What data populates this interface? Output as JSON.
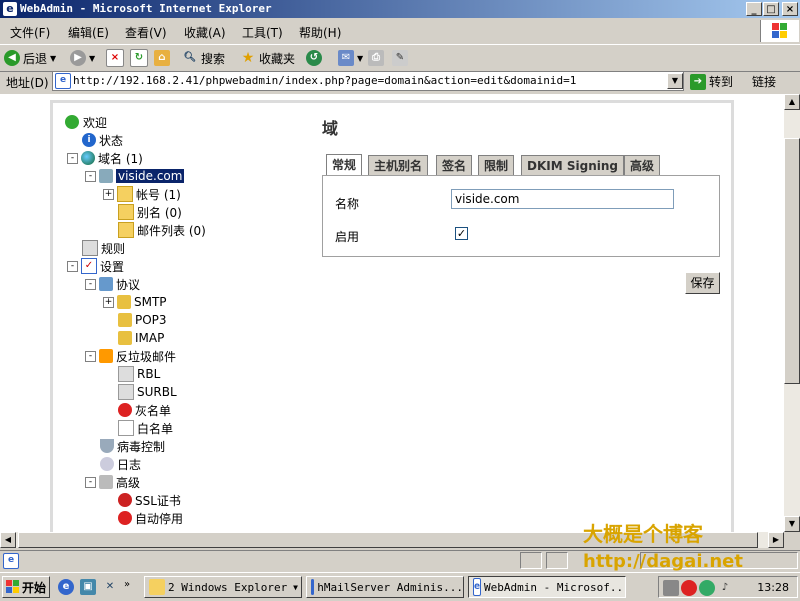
{
  "window": {
    "title": "WebAdmin - Microsoft Internet Explorer",
    "minimize": "_",
    "maximize": "□",
    "close": "×"
  },
  "menu": [
    "文件(F)",
    "编辑(E)",
    "查看(V)",
    "收藏(A)",
    "工具(T)",
    "帮助(H)"
  ],
  "toolbar": {
    "back": "后退",
    "search": "搜索",
    "favorites": "收藏夹"
  },
  "address": {
    "label": "地址(D)",
    "url": "http://192.168.2.41/phpwebadmin/index.php?page=domain&action=edit&domainid=1",
    "go": "转到",
    "links": "链接"
  },
  "tree": {
    "welcome": "欢迎",
    "status": "状态",
    "domains": "域名 (1)",
    "domain_item": "viside.com",
    "accounts": "帐号 (1)",
    "aliases": "别名 (0)",
    "lists": "邮件列表 (0)",
    "rules": "规则",
    "settings": "设置",
    "protocols": "协议",
    "smtp": "SMTP",
    "pop3": "POP3",
    "imap": "IMAP",
    "antispam": "反垃圾邮件",
    "rbl": "RBL",
    "surbl": "SURBL",
    "greylist": "灰名单",
    "whitelist": "白名单",
    "antivirus": "病毒控制",
    "logging": "日志",
    "advanced": "高级",
    "ssl": "SSL证书",
    "autoban": "自动停用"
  },
  "main": {
    "title": "域",
    "tabs": [
      "常规",
      "主机别名",
      "签名",
      "限制",
      "DKIM Signing",
      "高级"
    ],
    "name_label": "名称",
    "name_value": "viside.com",
    "enabled_label": "启用",
    "enabled": true,
    "save": "保存"
  },
  "taskbar": {
    "start": "开始",
    "task1": "2 Windows Explorer",
    "task2": "hMailServer Adminis...",
    "task3": "WebAdmin - Microsof...",
    "clock": "13:28"
  },
  "watermark": {
    "line1": "大概是个博客",
    "line2": "http://dagai.net"
  }
}
